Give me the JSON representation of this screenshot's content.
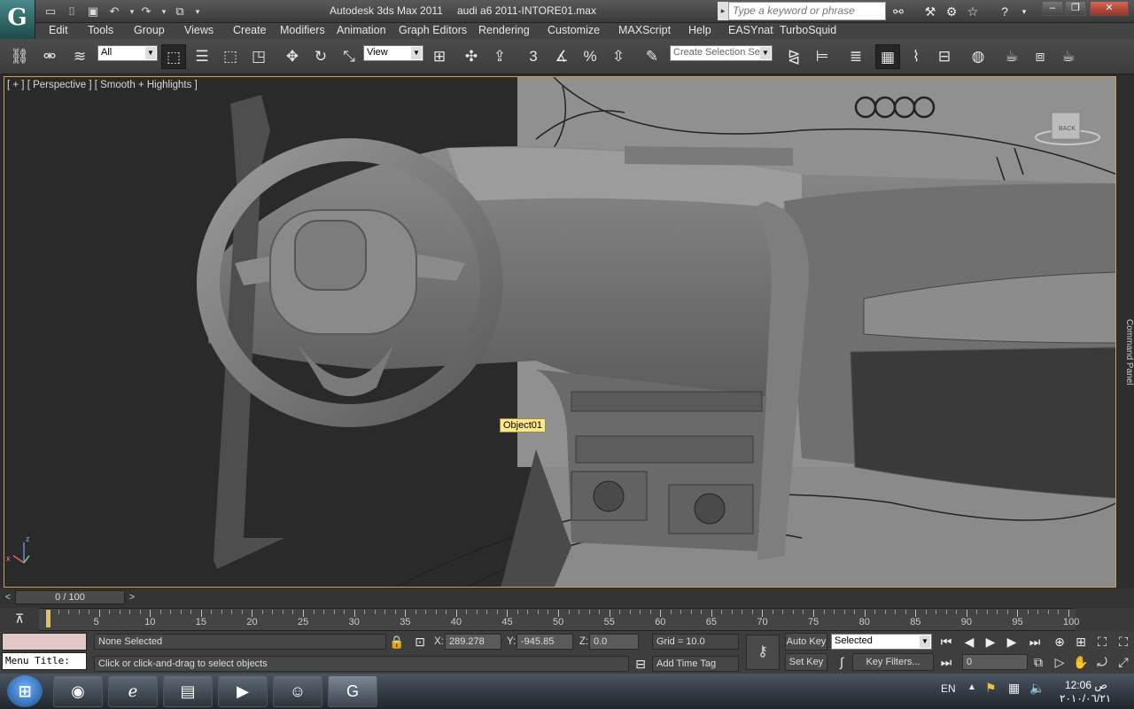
{
  "window": {
    "app_title": "Autodesk 3ds Max  2011",
    "file_title": "audi a6 2011-INTORE01.max",
    "search_placeholder": "Type a keyword or phrase"
  },
  "menu": [
    "Edit",
    "Tools",
    "Group",
    "Views",
    "Create",
    "Modifiers",
    "Animation",
    "Graph Editors",
    "Rendering",
    "Customize",
    "MAXScript",
    "Help",
    "EASYnat",
    "TurboSquid"
  ],
  "toolbar": {
    "selection_filter": "All",
    "reference_coord": "View",
    "named_selection_placeholder": "Create Selection Se",
    "snap_label": "3",
    "percent_label": "%"
  },
  "viewport": {
    "label": "[ + ] [ Perspective ] [ Smooth + Highlights ]",
    "tooltip": "Object01",
    "viewcube_face": "BACK",
    "axis_x": "x",
    "axis_z": "z"
  },
  "command_panel": {
    "label": "Command Panel"
  },
  "timeline": {
    "slider": "0 / 100",
    "prev": "<",
    "next": ">",
    "ticks": [
      "5",
      "10",
      "15",
      "20",
      "25",
      "30",
      "35",
      "40",
      "45",
      "50",
      "55",
      "60",
      "65",
      "70",
      "75",
      "80",
      "85",
      "90",
      "95",
      "100"
    ]
  },
  "status": {
    "maxscript_label": "Menu Title:",
    "selection": "None Selected",
    "prompt": "Click or click-and-drag to select objects",
    "x_label": "X:",
    "x_value": "289.278",
    "y_label": "Y:",
    "y_value": "-945.85",
    "z_label": "Z:",
    "z_value": "0.0",
    "grid": "Grid = 10.0",
    "add_time_tag": "Add Time Tag",
    "auto_key": "Auto Key",
    "set_key": "Set Key",
    "key_mode": "Selected",
    "key_filters": "Key Filters...",
    "current_frame": "0"
  },
  "taskbar": {
    "lang": "EN",
    "time": "12:06 ص",
    "date": "٢٠١٠/٠٦/٢١"
  }
}
